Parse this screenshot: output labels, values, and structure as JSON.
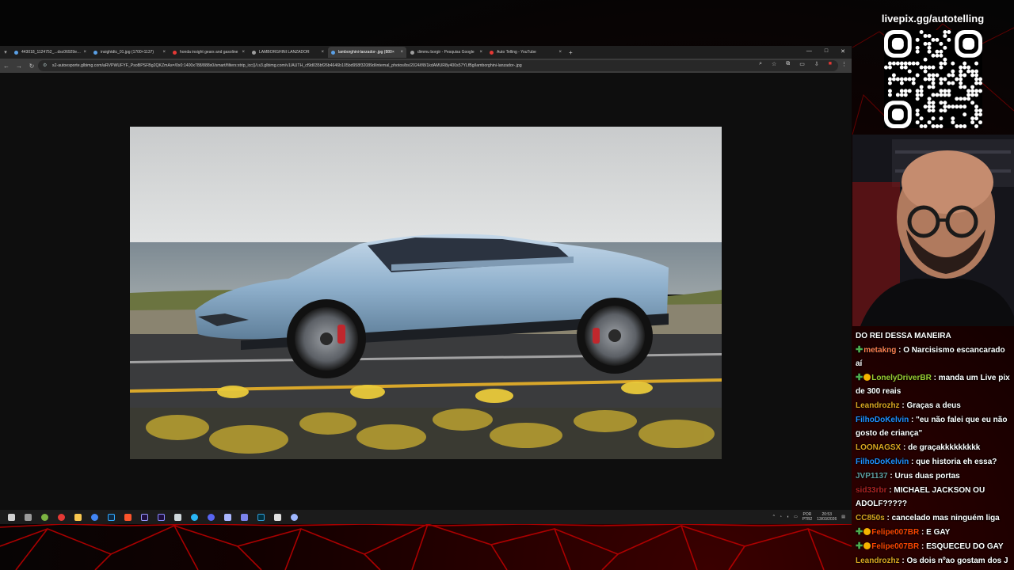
{
  "overlay": {
    "livepix": "livepix.gg/autotelling"
  },
  "browser": {
    "tabs": [
      {
        "label": "443018_1124752_...dsc06929e.jpg",
        "color": "#5aa0e6",
        "active": false
      },
      {
        "label": "insightdtc_01.jpg (1700×1137)",
        "color": "#5aa0e6",
        "active": false
      },
      {
        "label": "honda insight gears and gasoline",
        "color": "#e53935",
        "active": false
      },
      {
        "label": "LAMBORGHINI LANZADOR",
        "color": "#9e9e9e",
        "active": false
      },
      {
        "label": "lamborghini-lanzador-.jpg (880×",
        "color": "#5aa0e6",
        "active": true
      },
      {
        "label": "dimmu borgir - Pesquisa Google",
        "color": "#9e9e9e",
        "active": false
      },
      {
        "label": "Auto Telling - YouTube",
        "color": "#e53935",
        "active": false
      }
    ],
    "url": "s2-autoesporte.glbimg.com/aRVPWUFYF_PsoBPSFBg2QKZmAs=/0x0:1400x788/888x0/smart/filters:strip_icc()/i.s3.glbimg.com/v1/AUTH_cf9d035bf26b4646b105bd958f32089d/internal_photos/bs/2024/f/8/1kdAMUR8y400s57YLfBg/lamborghini-lanzador-.jpg"
  },
  "taskbar": {
    "icons": [
      {
        "name": "start-icon",
        "color": "#d0d0d0"
      },
      {
        "name": "task-view-icon",
        "color": "#9a9a9a"
      },
      {
        "name": "browser-app-icon",
        "color": "#7cb342"
      },
      {
        "name": "obs-icon",
        "color": "#e53935"
      },
      {
        "name": "file-explorer-icon",
        "color": "#f9c74f"
      },
      {
        "name": "chrome-icon",
        "color": "#4285f4"
      },
      {
        "name": "photoshop-icon",
        "color": "#31a8ff"
      },
      {
        "name": "brave-icon",
        "color": "#fb542b"
      },
      {
        "name": "premiere-icon",
        "color": "#9999ff"
      },
      {
        "name": "media-encoder-icon",
        "color": "#8a8aff"
      },
      {
        "name": "notes-icon",
        "color": "#cfd8dc"
      },
      {
        "name": "edge-icon",
        "color": "#29b6f6"
      },
      {
        "name": "discord-icon",
        "color": "#5865f2"
      },
      {
        "name": "calendar-icon",
        "color": "#aab7ff"
      },
      {
        "name": "teams-icon",
        "color": "#7b83eb"
      },
      {
        "name": "audition-icon",
        "color": "#2f9bd6"
      },
      {
        "name": "capcut-icon",
        "color": "#e0e0e0"
      },
      {
        "name": "network-icon",
        "color": "#9fb7ff"
      }
    ],
    "lang": "POR",
    "lang2": "PTB2",
    "time": "20:53",
    "date": "13/03/2026"
  },
  "chat": [
    {
      "user": "",
      "text": "DO REI DESSA MANEIRA",
      "color": "#ffffff",
      "badges": []
    },
    {
      "user": "metakng",
      "text": "O Narcisismo escancarado aí",
      "color": "#ff7f50",
      "badges": [
        "green"
      ]
    },
    {
      "user": "LonelyDriverBR",
      "text": "manda um Live pix de 300 reais",
      "color": "#9acd32",
      "badges": [
        "green",
        "gold"
      ]
    },
    {
      "user": "Leandrozhz",
      "text": "Graças a deus",
      "color": "#daa520",
      "badges": []
    },
    {
      "user": "FilhoDoKelvin",
      "text": "\"eu não falei que eu não gosto de criança\"",
      "color": "#1e90ff",
      "badges": []
    },
    {
      "user": "LOONAGSX",
      "text": "de graçakkkkkkkkk",
      "color": "#daa520",
      "badges": []
    },
    {
      "user": "FilhoDoKelvin",
      "text": "que historia eh essa?",
      "color": "#1e90ff",
      "badges": []
    },
    {
      "user": "JVP1137",
      "text": "Urus duas portas",
      "color": "#5f9ea0",
      "badges": []
    },
    {
      "user": "sid33rbr",
      "text": "MICHAEL JACKSON OU ADOLF?????",
      "color": "#b22222",
      "badges": []
    },
    {
      "user": "CC850s",
      "text": "cancelado mas ninguém liga",
      "color": "#daa520",
      "badges": []
    },
    {
      "user": "Felipe007BR",
      "text": "E GAY",
      "color": "#ff4500",
      "badges": [
        "green",
        "gold"
      ]
    },
    {
      "user": "Felipe007BR",
      "text": "ESQUECEU DO GAY",
      "color": "#ff4500",
      "badges": [
        "green",
        "gold"
      ]
    },
    {
      "user": "Leandrozhz",
      "text": "Os dois nºao gostam dos J",
      "color": "#daa520",
      "badges": []
    }
  ]
}
